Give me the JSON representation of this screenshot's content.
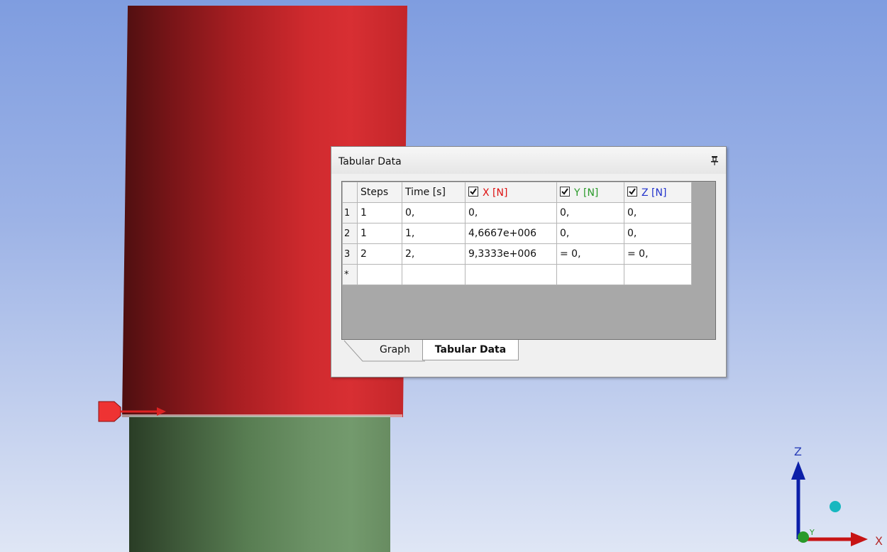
{
  "viewport": {
    "geometry_colors": {
      "upper_body": "#c3262a",
      "lower_body": "#6c9266",
      "force_marker": "#e33"
    },
    "triad": {
      "x_label": "X",
      "y_label": "Y",
      "z_label": "Z"
    }
  },
  "tabular_panel": {
    "title": "Tabular Data",
    "pin_icon": "pin-icon",
    "columns": {
      "steps": "Steps",
      "time": "Time [s]",
      "x": "X [N]",
      "y": "Y [N]",
      "z": "Z [N]"
    },
    "rows": [
      {
        "num": "1",
        "steps": "1",
        "time": "0,",
        "x": "0,",
        "y": "0,",
        "z": "0,"
      },
      {
        "num": "2",
        "steps": "1",
        "time": "1,",
        "x": "4,6667e+006",
        "y": "0,",
        "z": "0,"
      },
      {
        "num": "3",
        "steps": "2",
        "time": "2,",
        "x": "9,3333e+006",
        "y": "= 0,",
        "z": "= 0,"
      },
      {
        "num": "*",
        "steps": "",
        "time": "",
        "x": "",
        "y": "",
        "z": ""
      }
    ],
    "tabs": {
      "graph": "Graph",
      "tabular": "Tabular Data"
    }
  }
}
